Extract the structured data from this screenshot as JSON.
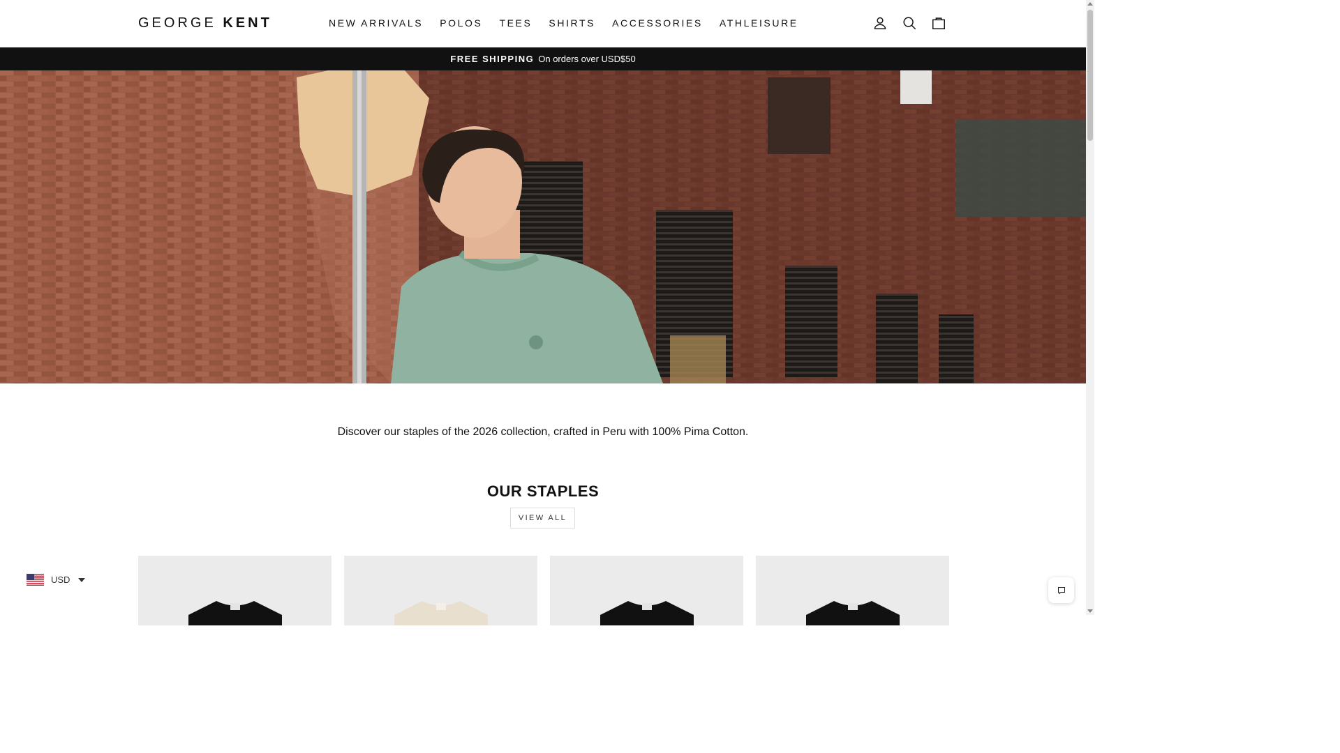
{
  "brand": {
    "logo_light": "GEORGE",
    "logo_bold": "KENT"
  },
  "nav": {
    "items": [
      {
        "label": "NEW ARRIVALS"
      },
      {
        "label": "POLOS"
      },
      {
        "label": "TEES"
      },
      {
        "label": "SHIRTS"
      },
      {
        "label": "ACCESSORIES"
      },
      {
        "label": "ATHLEISURE"
      }
    ]
  },
  "header_icons": [
    "account-icon",
    "search-icon",
    "cart-icon"
  ],
  "announcement": {
    "strong": "FREE SHIPPING",
    "text": "On orders over USD$50"
  },
  "intro": {
    "text": "Discover our staples of the 2026 collection, crafted in Peru with 100% Pima Cotton."
  },
  "staples": {
    "title": "OUR STAPLES",
    "view_all": "VIEW ALL"
  },
  "products": [
    {
      "color": "#111111"
    },
    {
      "color": "#e8dfcf"
    },
    {
      "color": "#111111"
    },
    {
      "color": "#111111"
    }
  ],
  "currency": {
    "code": "USD"
  },
  "colors": {
    "accent": "#111111",
    "announce_bg": "#111111",
    "product_bg": "#ebebeb",
    "tee_green": "#8fb3a0"
  }
}
